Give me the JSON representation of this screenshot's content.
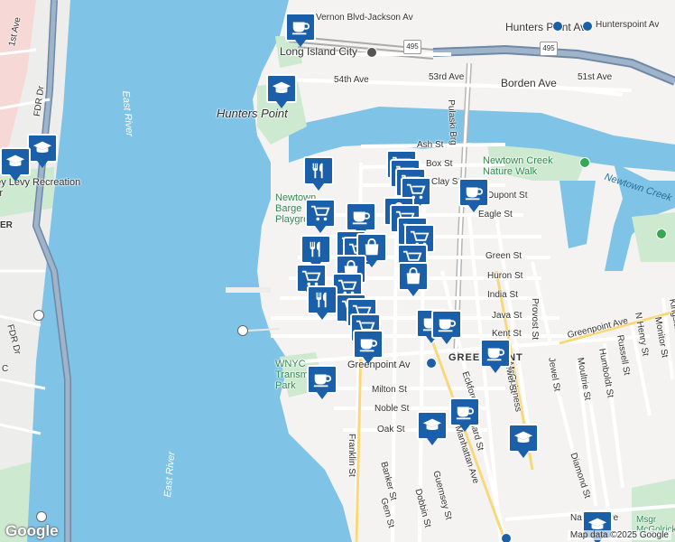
{
  "map": {
    "streets": [
      {
        "name": "Vernon Blvd-Jackson Av",
        "id": "vernon"
      },
      {
        "name": "Hunters Point Av",
        "id": "hp-av"
      },
      {
        "name": "Hunterspoint Av",
        "id": "hp-av2"
      },
      {
        "name": "Long Island City",
        "id": "lic"
      },
      {
        "name": "54th Ave",
        "id": "54th"
      },
      {
        "name": "53rd Ave",
        "id": "53rd"
      },
      {
        "name": "Borden Ave",
        "id": "borden"
      },
      {
        "name": "51st Ave",
        "id": "51st"
      },
      {
        "name": "Pulaski Brg",
        "id": "pulaski"
      },
      {
        "name": "Ash St",
        "id": "ash"
      },
      {
        "name": "Box St",
        "id": "box"
      },
      {
        "name": "Clay St",
        "id": "clay"
      },
      {
        "name": "Dupont St",
        "id": "dupont"
      },
      {
        "name": "Eagle St",
        "id": "eagle"
      },
      {
        "name": "Green St",
        "id": "green"
      },
      {
        "name": "Huron St",
        "id": "huron"
      },
      {
        "name": "India St",
        "id": "india"
      },
      {
        "name": "Java St",
        "id": "java"
      },
      {
        "name": "Kent St",
        "id": "kent"
      },
      {
        "name": "Greenpoint Av",
        "id": "gp-av"
      },
      {
        "name": "Greenpoint Ave",
        "id": "gp-ave"
      },
      {
        "name": "Milton St",
        "id": "milton"
      },
      {
        "name": "Noble St",
        "id": "noble"
      },
      {
        "name": "Oak St",
        "id": "oak"
      },
      {
        "name": "Franklin St",
        "id": "franklin"
      },
      {
        "name": "Manhattan Ave",
        "id": "manhattan"
      },
      {
        "name": "Eckford St",
        "id": "eckford"
      },
      {
        "name": "McGuinness",
        "id": "mcg"
      },
      {
        "name": "Provost St",
        "id": "provost"
      },
      {
        "name": "Jewel St",
        "id": "jewel"
      },
      {
        "name": "Moultrie St",
        "id": "moultrie"
      },
      {
        "name": "Humboldt St",
        "id": "humboldt"
      },
      {
        "name": "Russell St",
        "id": "russell"
      },
      {
        "name": "N Henry St",
        "id": "nhenry"
      },
      {
        "name": "Monitor St",
        "id": "monitor"
      },
      {
        "name": "Kingsland",
        "id": "kingsland"
      },
      {
        "name": "Diamond St",
        "id": "diamond"
      },
      {
        "name": "Guernsey St",
        "id": "guernsey"
      },
      {
        "name": "Dobbin St",
        "id": "dobbin"
      },
      {
        "name": "Banker St",
        "id": "banker"
      },
      {
        "name": "Gem St",
        "id": "gem"
      },
      {
        "name": "Nassau Ave",
        "id": "nassau"
      },
      {
        "name": "Newel St",
        "id": "newel"
      },
      {
        "name": "1st Ave",
        "id": "1st"
      },
      {
        "name": "FDR Dr",
        "id": "fdr"
      },
      {
        "name": "FDR Dr",
        "id": "fdr2"
      },
      {
        "name": "Leonard St",
        "id": "leonard"
      },
      {
        "name": "C",
        "id": "c"
      },
      {
        "name": "ER",
        "id": "er"
      }
    ],
    "water": [
      {
        "name": "East River"
      },
      {
        "name": "East River"
      }
    ],
    "places": {
      "hunters_point": "Hunters Point",
      "greenpoint": "GREENPOINT",
      "newtown_creek": "Newtown Creek",
      "newtown_nature": "Newtown Creek Nature Walk",
      "newtown_barge": "Newtown Barge Playground",
      "wnyc": "WNYC Transmitter Park",
      "levy": "Stanley Levy Recreation Center",
      "mcgolrick": "Msgr McGolrick"
    },
    "shields": [
      {
        "text": "495"
      },
      {
        "text": "495"
      }
    ],
    "credit": "Map data ©2025 Google",
    "logo": "Google"
  }
}
